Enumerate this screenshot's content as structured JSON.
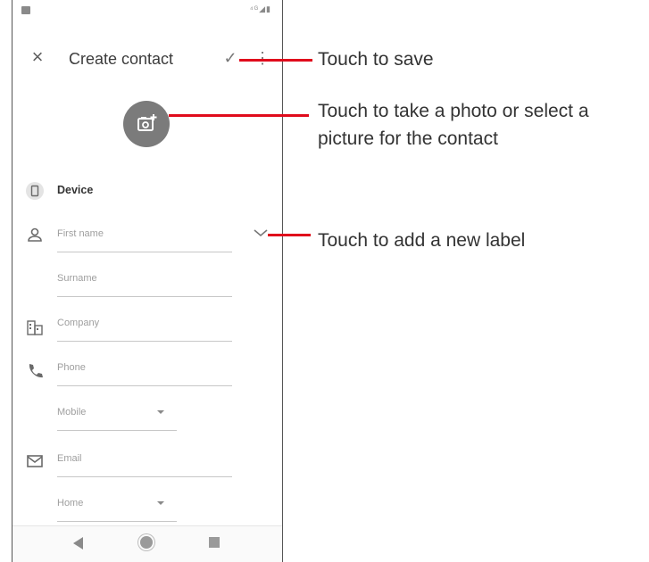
{
  "status_bar": {
    "right_icons": "⁴ᴳ◢▮"
  },
  "app_bar": {
    "close_icon": "×",
    "title": "Create contact",
    "save_icon": "✓",
    "more_icon": "⋮"
  },
  "account": {
    "label": "Device"
  },
  "fields": {
    "first_name": "First name",
    "surname": "Surname",
    "company": "Company",
    "phone": "Phone",
    "phone_type": "Mobile",
    "email": "Email",
    "email_type": "Home"
  },
  "callouts": {
    "save": "Touch to save",
    "photo_line1": "Touch to take a photo or select a",
    "photo_line2": "picture for the contact",
    "label": "Touch to add a new label"
  },
  "colors": {
    "callout_line": "#e00b1c",
    "icon_gray": "#7b7b7b"
  }
}
